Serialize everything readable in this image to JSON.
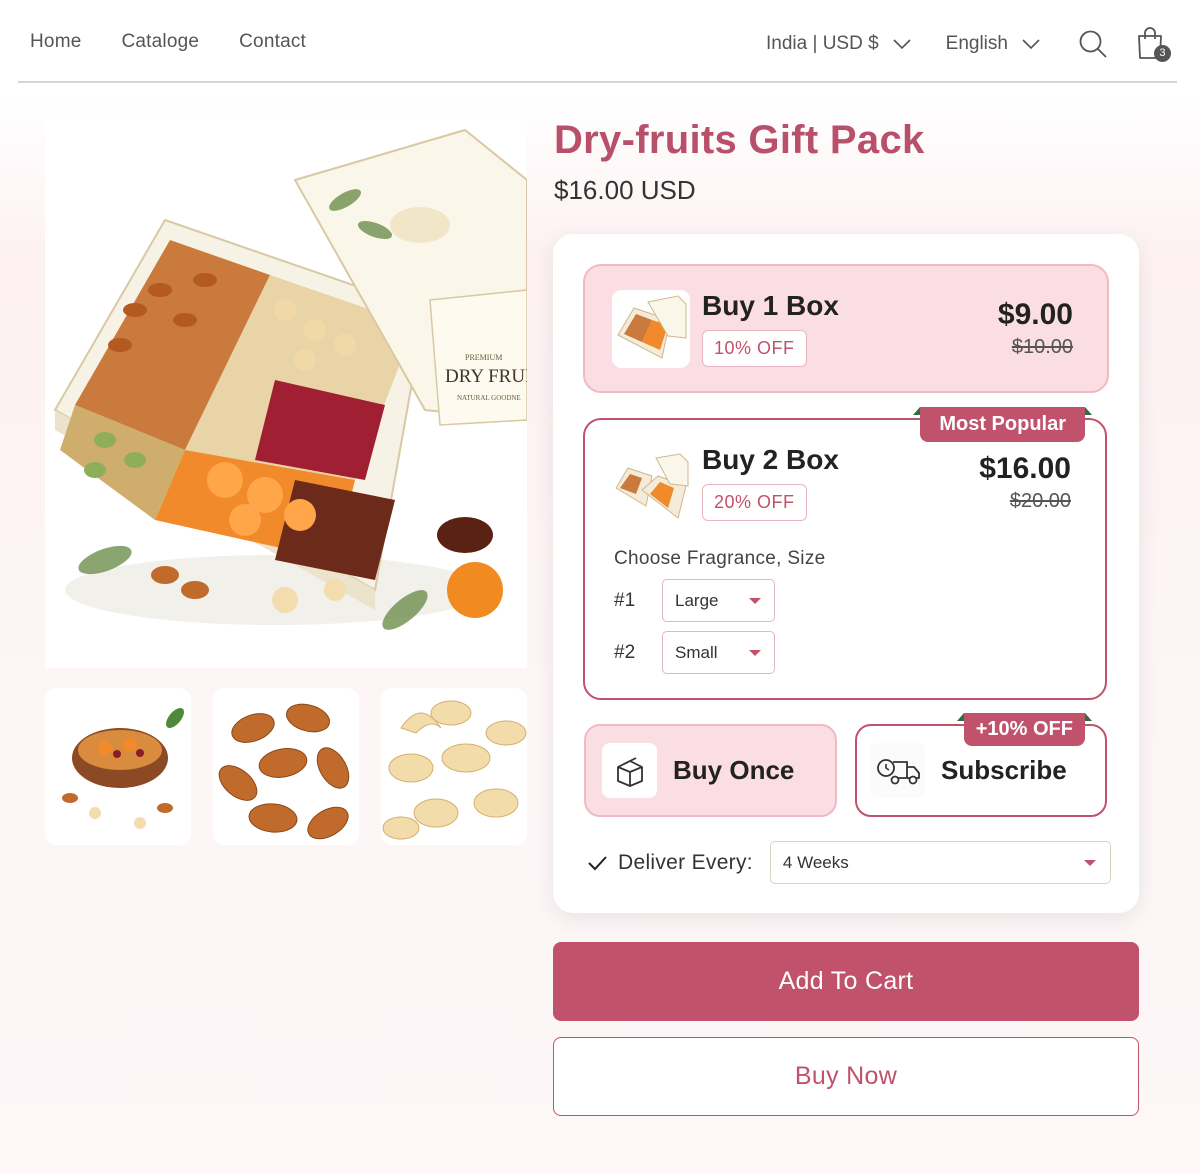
{
  "nav": {
    "items": [
      "Home",
      "Cataloge",
      "Contact"
    ]
  },
  "tools": {
    "region": "India | USD $",
    "language": "English",
    "cart_count": "3"
  },
  "product": {
    "title": "Dry-fruits Gift Pack",
    "price": "$16.00 USD",
    "box_label_top": "PREMIUM",
    "box_label_main": "DRY FRUI",
    "box_label_sub": "NATURAL GOODNE"
  },
  "bundles": [
    {
      "name": "Buy 1 Box",
      "discount": "10% OFF",
      "price": "$9.00",
      "old_price": "$10.00"
    },
    {
      "name": "Buy 2 Box",
      "discount": "20% OFF",
      "price": "$16.00",
      "old_price": "$20.00",
      "tag": "Most Popular"
    }
  ],
  "variants": {
    "label": "Choose Fragrance, Size",
    "rows": [
      {
        "num": "#1",
        "value": "Large"
      },
      {
        "num": "#2",
        "value": "Small"
      }
    ]
  },
  "purchase": {
    "once_label": "Buy Once",
    "subscribe_label": "Subscribe",
    "subscribe_tag": "+10% OFF"
  },
  "delivery": {
    "label": "Deliver Every:",
    "value": "4 Weeks"
  },
  "actions": {
    "add_to_cart": "Add To Cart",
    "buy_now": "Buy Now"
  },
  "colors": {
    "accent": "#c0526b",
    "accent_light": "#fbdee3",
    "tag_fold": "#2f6e3f"
  }
}
